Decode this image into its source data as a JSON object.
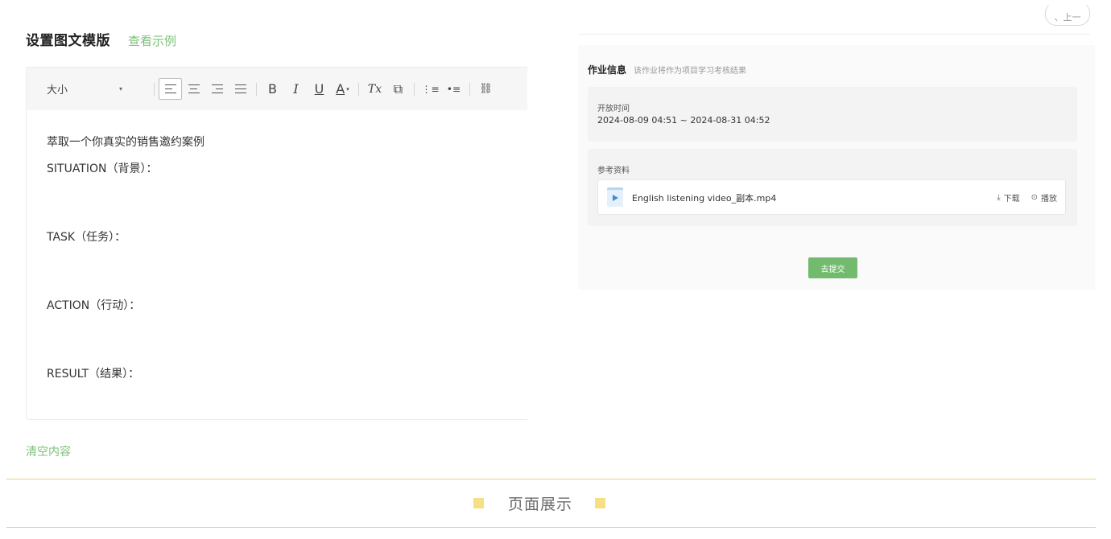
{
  "left": {
    "title": "设置图文模版",
    "example_link": "查看示例",
    "toolbar": {
      "size_label": "大小",
      "size_caret": "▾",
      "bold": "B",
      "italic": "I",
      "underline": "U",
      "font_color": "A",
      "clear_format": "Tx",
      "paste_icon": "⧉",
      "ordered_list_icon": "⋮≡",
      "bullet_list_icon": "•≡",
      "link_icon": "⛓"
    },
    "content_lines": [
      "萃取一个你真实的销售邀约案例",
      "SITUATION（背景）：",
      "TASK（任务）：",
      "ACTION（行动）：",
      "RESULT（结果）："
    ],
    "clear_button": "清空内容"
  },
  "right": {
    "corner_text": "、上一",
    "info_title": "作业信息",
    "info_subtitle": "该作业将作为项目学习考核结果",
    "open_time_label": "开放时间",
    "open_time_value": "2024-08-09 04:51 ~ 2024-08-31 04:52",
    "materials_label": "参考资料",
    "file": {
      "name": "English listening video_副本.mp4",
      "download_icon": "⤓",
      "download_label": "下载",
      "play_icon": "⊙",
      "play_label": "播放"
    },
    "submit_label": "去提交"
  },
  "banner": {
    "text": "页面展示"
  },
  "colors": {
    "accent_green": "#7cc278",
    "button_green": "#72bb6e",
    "banner_gold": "#f7df86",
    "rule_gold": "#e7cf84"
  }
}
